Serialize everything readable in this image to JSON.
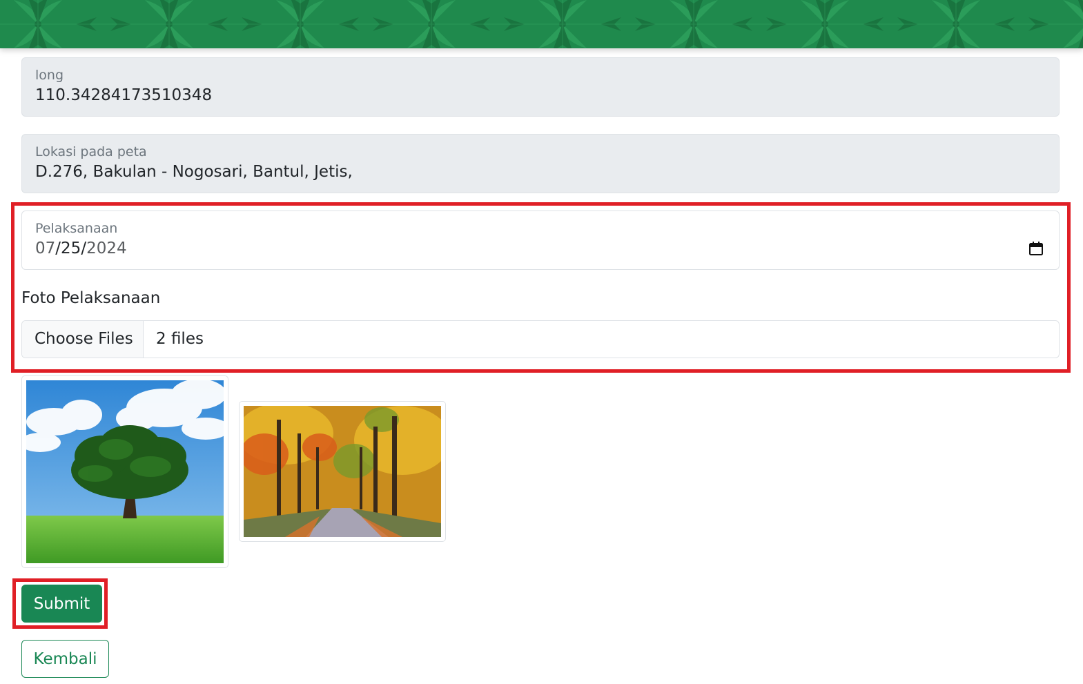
{
  "header": {
    "banner_color": "#1f8a4d"
  },
  "form": {
    "long": {
      "label": "long",
      "value": "110.34284173510348"
    },
    "lokasi": {
      "label": "Lokasi pada peta",
      "value": "D.276, Bakulan - Nogosari, Bantul, Jetis,"
    },
    "pelaksanaan": {
      "label": "Pelaksanaan",
      "month": "07",
      "sep1": "/",
      "day": "25",
      "sep2": "/",
      "year": "2024",
      "icon": "calendar-icon"
    },
    "foto": {
      "label": "Foto Pelaksanaan",
      "button_label": "Choose Files",
      "file_count": "2 files"
    }
  },
  "previews": {
    "items": [
      {
        "name": "tree-in-meadow"
      },
      {
        "name": "autumn-forest-road"
      }
    ]
  },
  "actions": {
    "submit_label": "Submit",
    "back_label": "Kembali"
  },
  "colors": {
    "primary": "#198754",
    "highlight": "#e01f26",
    "readonly_bg": "#e9ecef"
  }
}
